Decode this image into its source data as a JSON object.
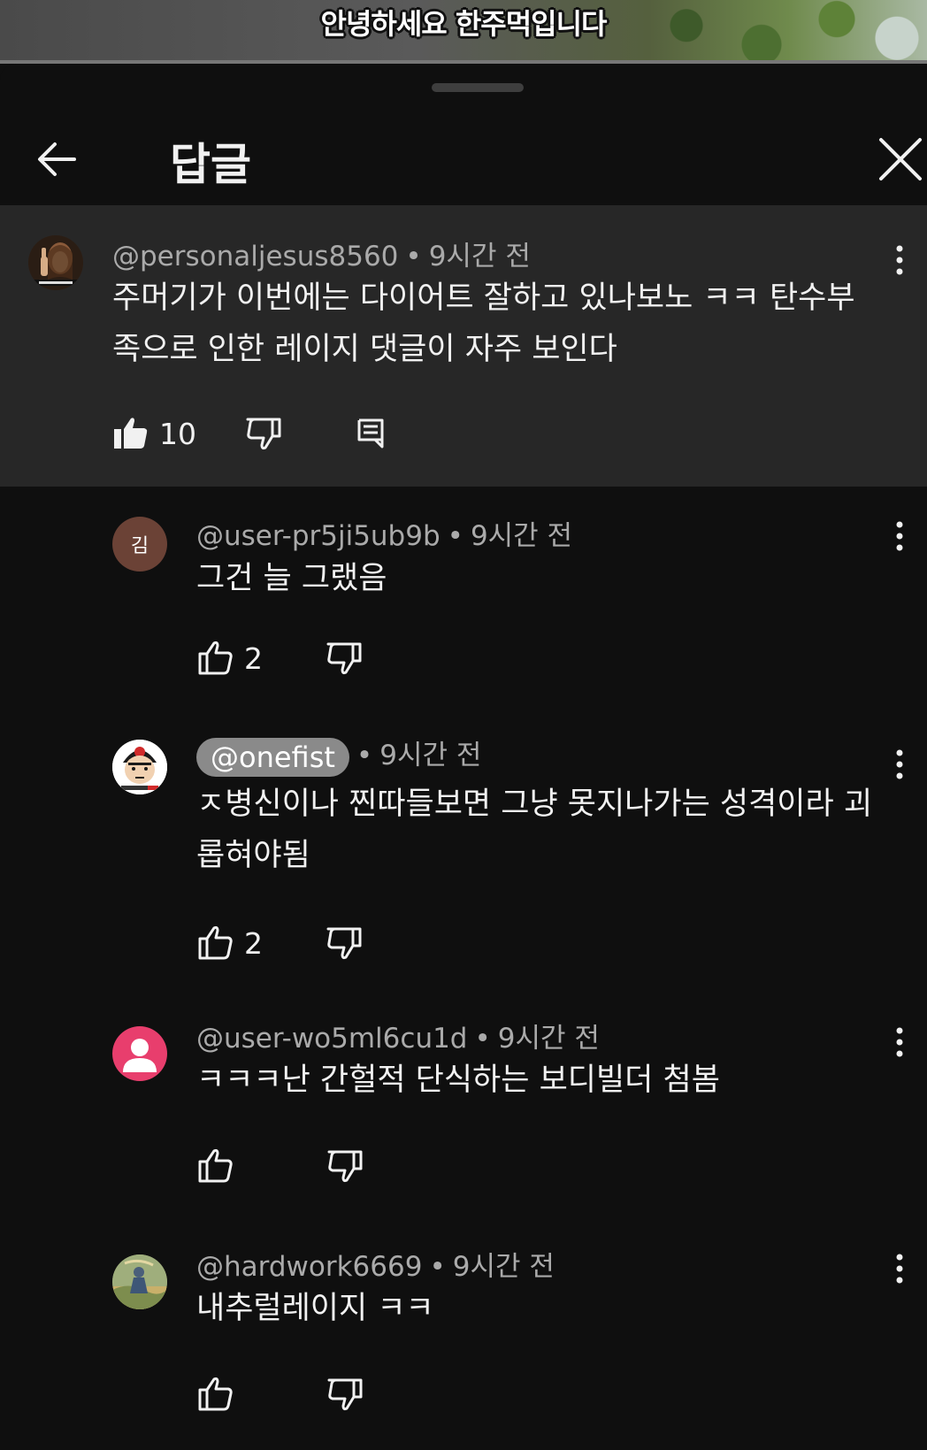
{
  "video": {
    "caption": "안녕하세요 한주먹입니다"
  },
  "header": {
    "title": "답글"
  },
  "parent_comment": {
    "author": "@personaljesus8560",
    "time": "9시간 전",
    "text": "주머기가 이번에는 다이어트 잘하고 있나보노 ㅋㅋ 탄수부족으로 인한 레이지 댓글이 자주 보인다",
    "likes": "10"
  },
  "replies": [
    {
      "author": "@user-pr5ji5ub9b",
      "avatar_letter": "김",
      "avatar_color": "#6b4236",
      "time": "9시간 전",
      "text": "그건 늘 그랬음",
      "likes": "2"
    },
    {
      "author": "@onefist",
      "time": "9시간 전",
      "text": "ㅈ병신이나 찐따들보면 그냥 못지나가는 성격이라 괴롭혀야됨",
      "likes": "2",
      "author_is_creator": true
    },
    {
      "author": "@user-wo5ml6cu1d",
      "avatar_color": "#e83e6d",
      "time": "9시간 전",
      "text": "ㅋㅋㅋ난 간헐적 단식하는 보디빌더 첨봄",
      "likes": ""
    },
    {
      "author": "@hardwork6669",
      "time": "9시간 전",
      "text": "내추럴레이지 ㅋㅋ",
      "likes": ""
    }
  ],
  "colors": {
    "background": "#0f0f0f",
    "highlight": "#272727",
    "secondary_text": "#aaaaaa",
    "chip": "#8a8a8a"
  }
}
